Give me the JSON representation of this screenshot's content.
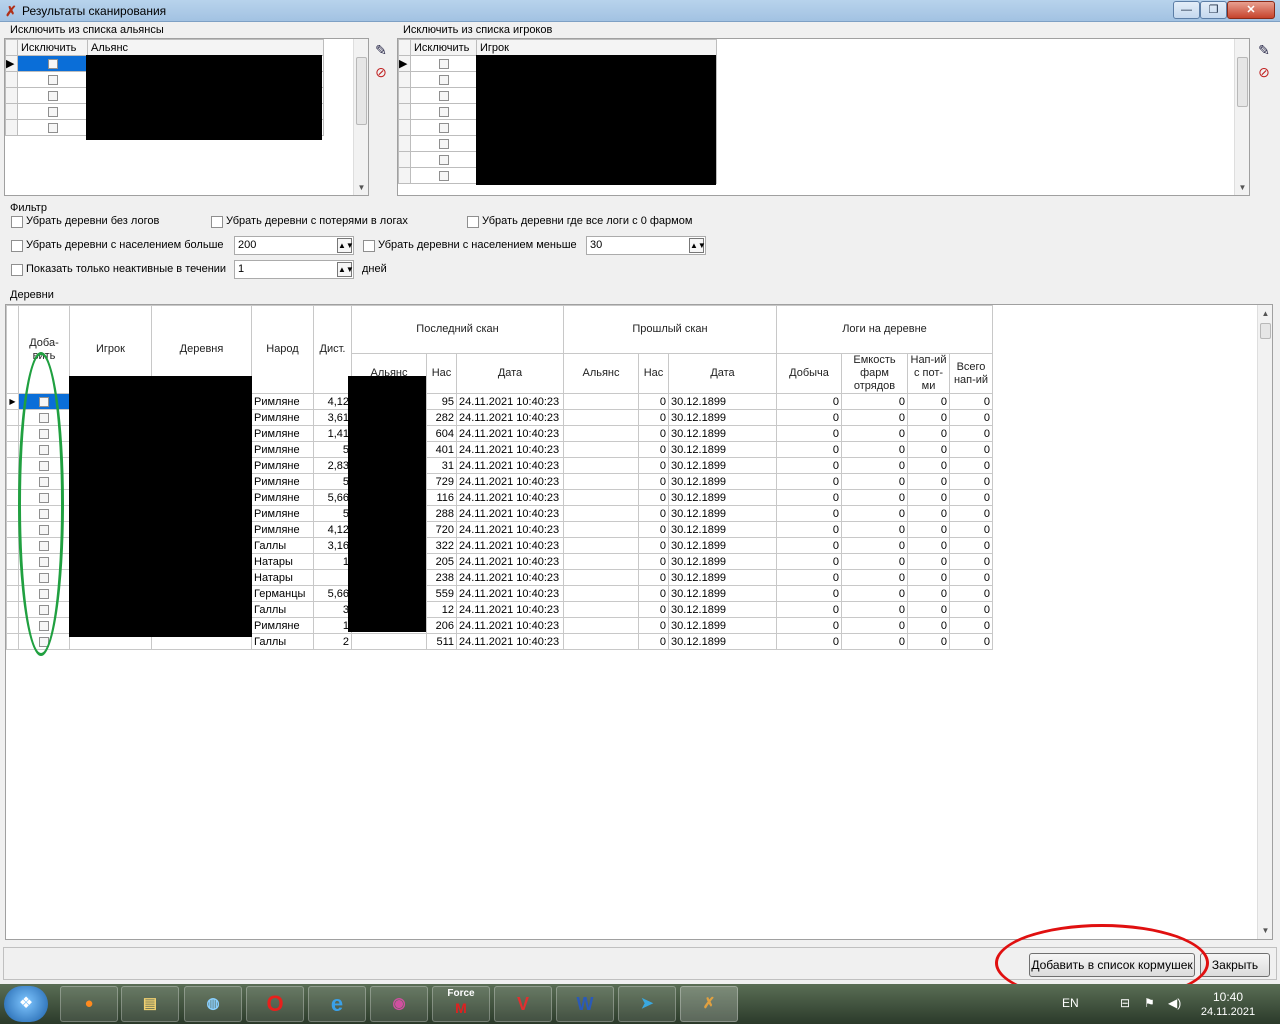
{
  "window": {
    "title": "Результаты сканирования",
    "minimize": "—",
    "maximize": "❐",
    "close": "✕"
  },
  "exclude_alliances": {
    "group_label": "Исключить из списка альянсы",
    "col_exclude": "Исключить",
    "col_alliance": "Альянс",
    "row_count": 5
  },
  "exclude_players": {
    "group_label": "Исключить из списка игроков",
    "col_exclude": "Исключить",
    "col_player": "Игрок",
    "row_count": 8
  },
  "filter": {
    "group_label": "Фильтр",
    "no_logs": "Убрать деревни без логов",
    "with_losses": "Убрать деревни с потерями в логах",
    "zero_farm": "Убрать деревни где все логи с 0 фармом",
    "pop_more_label": "Убрать деревни с населением больше",
    "pop_more_value": "200",
    "pop_less_label": "Убрать деревни с населением меньше",
    "pop_less_value": "30",
    "inactive_label": "Показать только неактивные в течении",
    "inactive_value": "1",
    "days": "дней"
  },
  "villages": {
    "group_label": "Деревни",
    "headers": {
      "add": "Доба-вить",
      "player": "Игрок",
      "village": "Деревня",
      "tribe": "Народ",
      "dist": "Дист.",
      "last_scan": "Последний скан",
      "prev_scan": "Прошлый скан",
      "logs": "Логи на деревне",
      "alliance": "Альянс",
      "pop": "Нас",
      "date": "Дата",
      "loot": "Добыча",
      "capacity": "Емкость фарм отрядов",
      "attacks_losses": "Нап-ий с пот-ми",
      "attacks_total": "Всего нап-ий"
    },
    "rows": [
      {
        "tribe": "Римляне",
        "dist": "4,12",
        "pop": "95",
        "date": "24.11.2021 10:40:23",
        "prev_pop": "0",
        "prev_date": "30.12.1899",
        "loot": "0",
        "cap": "0",
        "loss": "0",
        "total": "0"
      },
      {
        "tribe": "Римляне",
        "dist": "3,61",
        "pop": "282",
        "date": "24.11.2021 10:40:23",
        "prev_pop": "0",
        "prev_date": "30.12.1899",
        "loot": "0",
        "cap": "0",
        "loss": "0",
        "total": "0"
      },
      {
        "tribe": "Римляне",
        "dist": "1,41",
        "pop": "604",
        "date": "24.11.2021 10:40:23",
        "prev_pop": "0",
        "prev_date": "30.12.1899",
        "loot": "0",
        "cap": "0",
        "loss": "0",
        "total": "0"
      },
      {
        "tribe": "Римляне",
        "dist": "5",
        "pop": "401",
        "date": "24.11.2021 10:40:23",
        "prev_pop": "0",
        "prev_date": "30.12.1899",
        "loot": "0",
        "cap": "0",
        "loss": "0",
        "total": "0"
      },
      {
        "tribe": "Римляне",
        "dist": "2,83",
        "pop": "31",
        "date": "24.11.2021 10:40:23",
        "prev_pop": "0",
        "prev_date": "30.12.1899",
        "loot": "0",
        "cap": "0",
        "loss": "0",
        "total": "0"
      },
      {
        "tribe": "Римляне",
        "dist": "5",
        "pop": "729",
        "date": "24.11.2021 10:40:23",
        "prev_pop": "0",
        "prev_date": "30.12.1899",
        "loot": "0",
        "cap": "0",
        "loss": "0",
        "total": "0"
      },
      {
        "tribe": "Римляне",
        "dist": "5,66",
        "pop": "116",
        "date": "24.11.2021 10:40:23",
        "prev_pop": "0",
        "prev_date": "30.12.1899",
        "loot": "0",
        "cap": "0",
        "loss": "0",
        "total": "0"
      },
      {
        "tribe": "Римляне",
        "dist": "5",
        "pop": "288",
        "date": "24.11.2021 10:40:23",
        "prev_pop": "0",
        "prev_date": "30.12.1899",
        "loot": "0",
        "cap": "0",
        "loss": "0",
        "total": "0"
      },
      {
        "tribe": "Римляне",
        "dist": "4,12",
        "pop": "720",
        "date": "24.11.2021 10:40:23",
        "prev_pop": "0",
        "prev_date": "30.12.1899",
        "loot": "0",
        "cap": "0",
        "loss": "0",
        "total": "0"
      },
      {
        "tribe": "Галлы",
        "dist": "3,16",
        "pop": "322",
        "date": "24.11.2021 10:40:23",
        "prev_pop": "0",
        "prev_date": "30.12.1899",
        "loot": "0",
        "cap": "0",
        "loss": "0",
        "total": "0"
      },
      {
        "tribe": "Натары",
        "dist": "1",
        "pop": "205",
        "date": "24.11.2021 10:40:23",
        "prev_pop": "0",
        "prev_date": "30.12.1899",
        "loot": "0",
        "cap": "0",
        "loss": "0",
        "total": "0"
      },
      {
        "tribe": "Натары",
        "dist": "",
        "pop": "238",
        "date": "24.11.2021 10:40:23",
        "prev_pop": "0",
        "prev_date": "30.12.1899",
        "loot": "0",
        "cap": "0",
        "loss": "0",
        "total": "0"
      },
      {
        "tribe": "Германцы",
        "dist": "5,66",
        "pop": "559",
        "date": "24.11.2021 10:40:23",
        "prev_pop": "0",
        "prev_date": "30.12.1899",
        "loot": "0",
        "cap": "0",
        "loss": "0",
        "total": "0"
      },
      {
        "tribe": "Галлы",
        "dist": "3",
        "pop": "12",
        "date": "24.11.2021 10:40:23",
        "prev_pop": "0",
        "prev_date": "30.12.1899",
        "loot": "0",
        "cap": "0",
        "loss": "0",
        "total": "0"
      },
      {
        "tribe": "Римляне",
        "dist": "1",
        "pop": "206",
        "date": "24.11.2021 10:40:23",
        "prev_pop": "0",
        "prev_date": "30.12.1899",
        "loot": "0",
        "cap": "0",
        "loss": "0",
        "total": "0"
      },
      {
        "tribe": "Галлы",
        "dist": "2",
        "pop": "511",
        "date": "24.11.2021 10:40:23",
        "prev_pop": "0",
        "prev_date": "30.12.1899",
        "loot": "0",
        "cap": "0",
        "loss": "0",
        "total": "0"
      }
    ]
  },
  "buttons": {
    "add_to_feeders": "Добавить в список кормушек",
    "close": "Закрыть"
  },
  "taskbar": {
    "lang": "EN",
    "time": "10:40",
    "date": "24.11.2021",
    "apps": [
      "firefox-icon",
      "file-explorer-icon",
      "globe-app-icon",
      "opera-icon",
      "internet-explorer-icon",
      "database-icon",
      "force-app-icon",
      "vivaldi-icon",
      "word-icon",
      "telegram-icon",
      "scanner-app-icon"
    ],
    "force_label": "Force"
  },
  "colors": {
    "selection": "#0a6ed8",
    "annotation_green": "#20a040",
    "annotation_red": "#e01010"
  }
}
